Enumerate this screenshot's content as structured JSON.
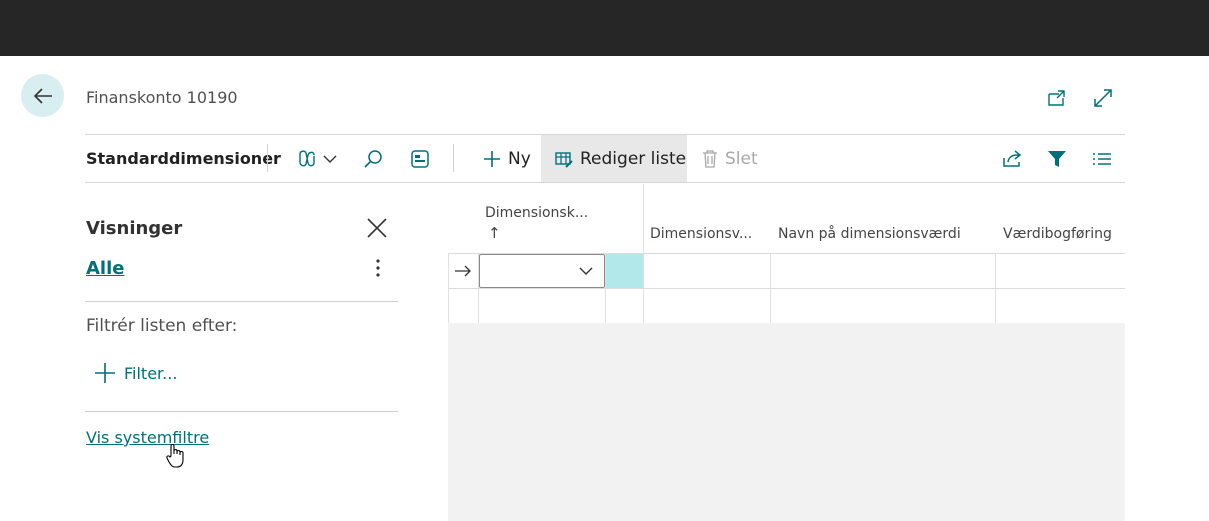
{
  "header": {
    "title": "Finanskonto 10190"
  },
  "toolbar": {
    "title": "Standarddimensioner",
    "new_label": "Ny",
    "edit_list_label": "Rediger liste",
    "delete_label": "Slet"
  },
  "views_pane": {
    "title": "Visninger",
    "active_view": "Alle",
    "filter_caption": "Filtrér listen efter:",
    "add_filter_label": "Filter...",
    "show_system_filters_label": "Vis systemfiltre"
  },
  "grid": {
    "columns": [
      {
        "label": "Dimensionsk...",
        "sort_indicator": "↑"
      },
      {
        "label": "Dimensionsv..."
      },
      {
        "label": "Navn på dimensionsværdi"
      },
      {
        "label": "Værdibogføring"
      }
    ],
    "rows": [
      {
        "dimension_code": "",
        "dimension_value": "",
        "dimension_value_name": "",
        "value_posting": ""
      },
      {
        "dimension_code": "",
        "dimension_value": "",
        "dimension_value_name": "",
        "value_posting": ""
      }
    ]
  },
  "colors": {
    "topbar": "#262626",
    "accent": "#00707a",
    "selected_cell": "#b3e8ea",
    "back_button_bg": "#d8eef0"
  },
  "icons": [
    "back-arrow-icon",
    "open-new-window-icon",
    "expand-icon",
    "copilot-icon",
    "chevron-down-icon",
    "search-icon",
    "edit-page-icon",
    "plus-icon",
    "edit-list-icon",
    "trash-icon",
    "share-icon",
    "filter-icon",
    "list-view-icon",
    "close-icon",
    "more-vertical-icon",
    "row-arrow-icon",
    "hand-cursor-icon"
  ]
}
